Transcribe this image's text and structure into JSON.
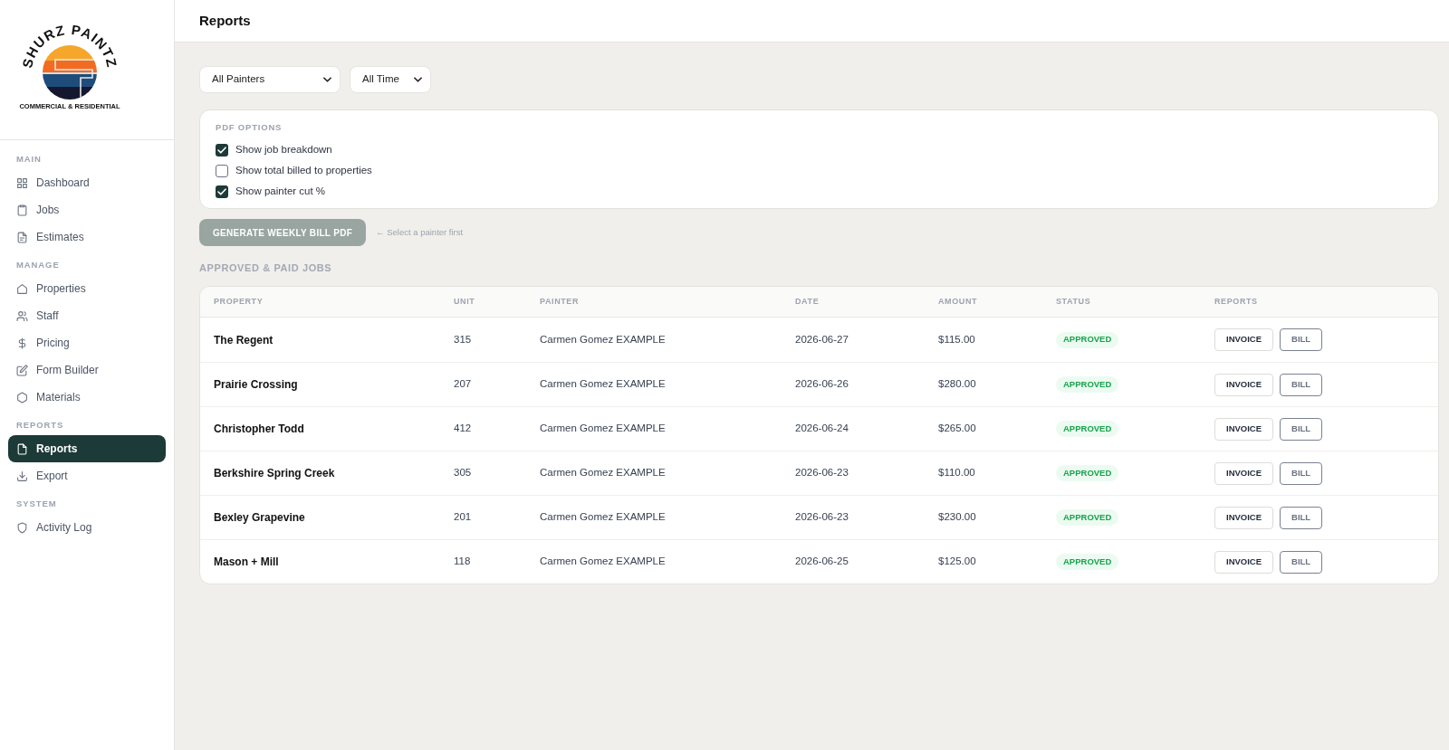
{
  "sidebar": {
    "brand": {
      "name": "SHURZ PAINTZ",
      "tagline": "COMMERCIAL & RESIDENTIAL"
    },
    "sections": [
      {
        "label": "MAIN",
        "items": [
          {
            "label": "Dashboard",
            "selected": false
          },
          {
            "label": "Jobs",
            "selected": false
          },
          {
            "label": "Estimates",
            "selected": false
          }
        ]
      },
      {
        "label": "MANAGE",
        "items": [
          {
            "label": "Properties",
            "selected": false
          },
          {
            "label": "Staff",
            "selected": false
          },
          {
            "label": "Pricing",
            "selected": false
          },
          {
            "label": "Form Builder",
            "selected": false
          },
          {
            "label": "Materials",
            "selected": false
          }
        ]
      },
      {
        "label": "REPORTS",
        "items": [
          {
            "label": "Reports",
            "selected": true
          },
          {
            "label": "Export",
            "selected": false
          }
        ]
      },
      {
        "label": "SYSTEM",
        "items": [
          {
            "label": "Activity Log",
            "selected": false
          }
        ]
      }
    ]
  },
  "header": {
    "title": "Reports"
  },
  "filters": [
    {
      "value": "All Painters"
    },
    {
      "value": "All Time"
    }
  ],
  "pdf_options": {
    "title": "PDF OPTIONS",
    "options": [
      {
        "label": "Show job breakdown",
        "checked": true
      },
      {
        "label": "Show total billed to properties",
        "checked": false
      },
      {
        "label": "Show painter cut %",
        "checked": true
      }
    ]
  },
  "generate": {
    "label": "GENERATE WEEKLY BILL PDF",
    "disabled": true,
    "hint": "← Select a painter first"
  },
  "jobs": {
    "title": "APPROVED & PAID JOBS",
    "columns": [
      "PROPERTY",
      "UNIT",
      "PAINTER",
      "DATE",
      "AMOUNT",
      "STATUS",
      "REPORTS"
    ],
    "rows": [
      {
        "property": "The Regent",
        "unit": "315",
        "painter": "Carmen Gomez EXAMPLE",
        "date": "2026-06-27",
        "amount": "$115.00",
        "status": "APPROVED",
        "actions": [
          {
            "kind": "invoice",
            "label": "INVOICE"
          },
          {
            "kind": "bill",
            "label": "BILL"
          }
        ]
      },
      {
        "property": "Prairie Crossing",
        "unit": "207",
        "painter": "Carmen Gomez EXAMPLE",
        "date": "2026-06-26",
        "amount": "$280.00",
        "status": "APPROVED",
        "actions": [
          {
            "kind": "invoice",
            "label": "INVOICE"
          },
          {
            "kind": "bill",
            "label": "BILL"
          }
        ]
      },
      {
        "property": "Christopher Todd",
        "unit": "412",
        "painter": "Carmen Gomez EXAMPLE",
        "date": "2026-06-24",
        "amount": "$265.00",
        "status": "APPROVED",
        "actions": [
          {
            "kind": "invoice",
            "label": "INVOICE"
          },
          {
            "kind": "bill",
            "label": "BILL"
          }
        ]
      },
      {
        "property": "Berkshire Spring Creek",
        "unit": "305",
        "painter": "Carmen Gomez EXAMPLE",
        "date": "2026-06-23",
        "amount": "$110.00",
        "status": "APPROVED",
        "actions": [
          {
            "kind": "invoice",
            "label": "INVOICE"
          },
          {
            "kind": "bill",
            "label": "BILL"
          }
        ]
      },
      {
        "property": "Bexley Grapevine",
        "unit": "201",
        "painter": "Carmen Gomez EXAMPLE",
        "date": "2026-06-23",
        "amount": "$230.00",
        "status": "APPROVED",
        "actions": [
          {
            "kind": "invoice",
            "label": "INVOICE"
          },
          {
            "kind": "bill",
            "label": "BILL"
          }
        ]
      },
      {
        "property": "Mason + Mill",
        "unit": "118",
        "painter": "Carmen Gomez EXAMPLE",
        "date": "2026-06-25",
        "amount": "$125.00",
        "status": "APPROVED",
        "actions": [
          {
            "kind": "invoice",
            "label": "INVOICE"
          },
          {
            "kind": "bill",
            "label": "BILL"
          }
        ]
      }
    ]
  }
}
